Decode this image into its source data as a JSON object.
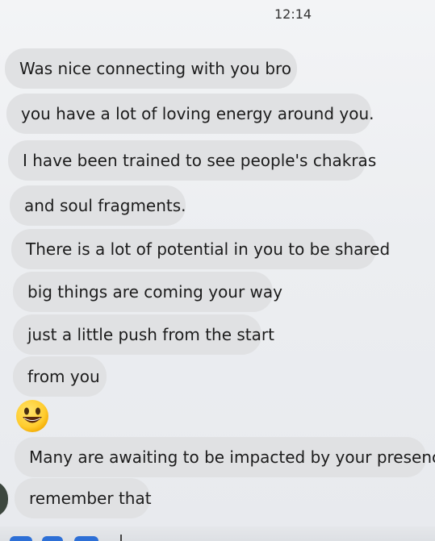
{
  "chat": {
    "timestamp": "12:14",
    "messages": [
      "Was nice connecting with you bro",
      "you have a lot of loving energy around you.",
      "I have been trained to see people's chakras",
      "and soul fragments.",
      "There is a lot of potential in you to be shared",
      "big things are coming your way",
      "just a little push from the start",
      "from you",
      "Many are awaiting to be impacted by your presence.",
      "remember that"
    ],
    "emoji": "grinning-face-emoji"
  },
  "colors": {
    "background": "#eceef1",
    "bubble": "#e0e1e3",
    "text": "#1c1c1c",
    "accent": "#2d6fd6"
  }
}
